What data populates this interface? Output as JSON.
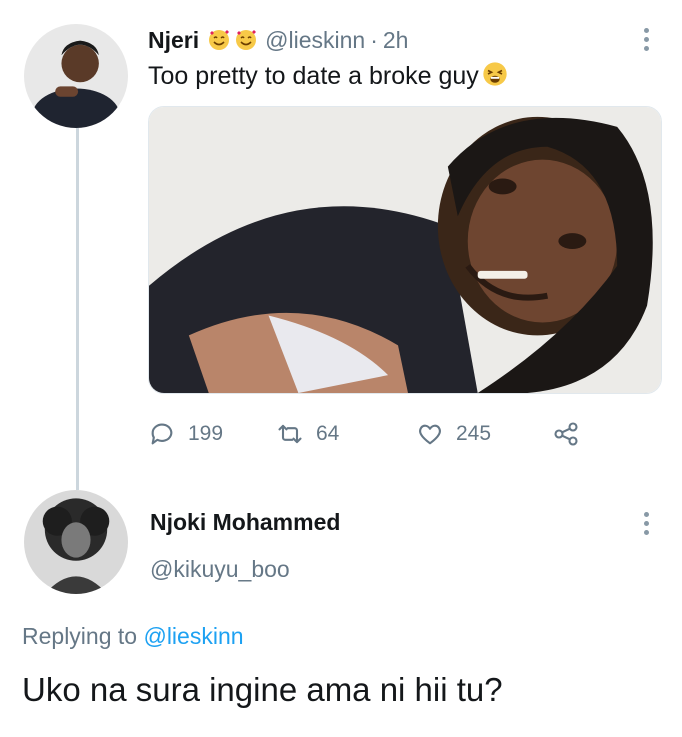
{
  "tweet": {
    "author_name": "Njeri",
    "author_handle": "@lieskinn",
    "separator": "·",
    "time": "2h",
    "text": "Too pretty to date a broke guy",
    "emojis_after_name": [
      "smiling-face-with-hearts",
      "smiling-face-with-hearts"
    ],
    "emoji_after_text": "weary-face",
    "stats": {
      "replies": "199",
      "retweets": "64",
      "likes": "245"
    }
  },
  "reply": {
    "author_name": "Njoki Mohammed",
    "author_handle": "@kikuyu_boo",
    "replying_prefix": "Replying to",
    "replying_to": "@lieskinn",
    "text": "Uko na sura ingine ama ni hii tu?"
  },
  "colors": {
    "text": "#14171a",
    "secondary": "#657786",
    "link": "#1da1f2",
    "thread_line": "#ccd6dd"
  }
}
